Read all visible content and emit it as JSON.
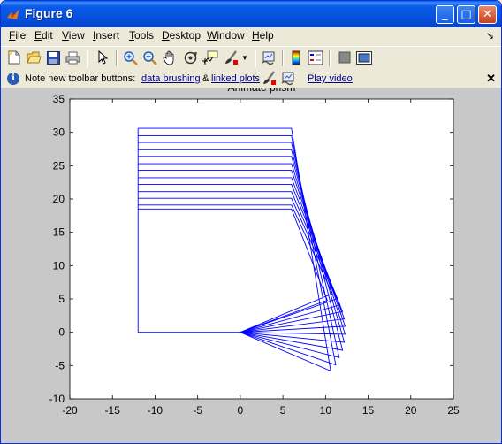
{
  "window": {
    "title": "Figure 6",
    "controls": {
      "minimize": "_",
      "maximize": "□",
      "close": "✕"
    }
  },
  "menu": {
    "items": [
      "File",
      "Edit",
      "View",
      "Insert",
      "Tools",
      "Desktop",
      "Window",
      "Help"
    ],
    "dock_arrow": "↘"
  },
  "toolbar": {
    "icons": [
      "new-file-icon",
      "open-folder-icon",
      "save-icon",
      "print-icon",
      "select-arrow-icon",
      "zoom-in-icon",
      "zoom-out-icon",
      "pan-hand-icon",
      "rotate-3d-icon",
      "data-cursor-icon",
      "brush-icon",
      "dropdown-arrow-icon",
      "link-plot-icon",
      "colorbar-icon",
      "legend-icon",
      "hide-plot-tools-icon",
      "show-plot-tools-icon"
    ]
  },
  "infobar": {
    "prefix": "Note new toolbar buttons:",
    "link1": "data brushing",
    "amp": "&",
    "link2": "linked plots",
    "link3": "Play video",
    "close": "✕"
  },
  "chart_data": {
    "type": "line",
    "title": "Animate prism",
    "title_partially_hidden": true,
    "xlim": [
      -20,
      25
    ],
    "ylim": [
      -10,
      35
    ],
    "xticks": [
      -20,
      -15,
      -10,
      -5,
      0,
      5,
      10,
      15,
      20,
      25
    ],
    "yticks": [
      -10,
      -5,
      0,
      5,
      10,
      15,
      20,
      25,
      30,
      35
    ],
    "color": "#0000ff",
    "static_segments": [
      {
        "x": [
          -12,
          -12
        ],
        "y": [
          0,
          30.6
        ]
      },
      {
        "x": [
          -12,
          0
        ],
        "y": [
          0,
          0
        ]
      }
    ],
    "frames": [
      {
        "top": 30.6,
        "tip": [
          10.6,
          -5.8
        ]
      },
      {
        "top": 29.5,
        "tip": [
          11.2,
          -4.9
        ]
      },
      {
        "top": 28.5,
        "tip": [
          11.6,
          -3.8
        ]
      },
      {
        "top": 27.4,
        "tip": [
          12.0,
          -2.7
        ]
      },
      {
        "top": 26.4,
        "tip": [
          12.2,
          -1.5
        ]
      },
      {
        "top": 25.3,
        "tip": [
          12.3,
          -0.3
        ]
      },
      {
        "top": 24.3,
        "tip": [
          12.3,
          0.9
        ]
      },
      {
        "top": 23.2,
        "tip": [
          12.2,
          2.0
        ]
      },
      {
        "top": 22.2,
        "tip": [
          12.0,
          3.1
        ]
      },
      {
        "top": 21.1,
        "tip": [
          11.7,
          4.1
        ]
      },
      {
        "top": 20.1,
        "tip": [
          11.3,
          5.0
        ]
      },
      {
        "top": 19.1,
        "tip": [
          10.8,
          5.8
        ]
      },
      {
        "top": 18.5,
        "tip": [
          10.2,
          4.8
        ]
      }
    ],
    "top_right_x": 6,
    "top_left_x": -12
  }
}
